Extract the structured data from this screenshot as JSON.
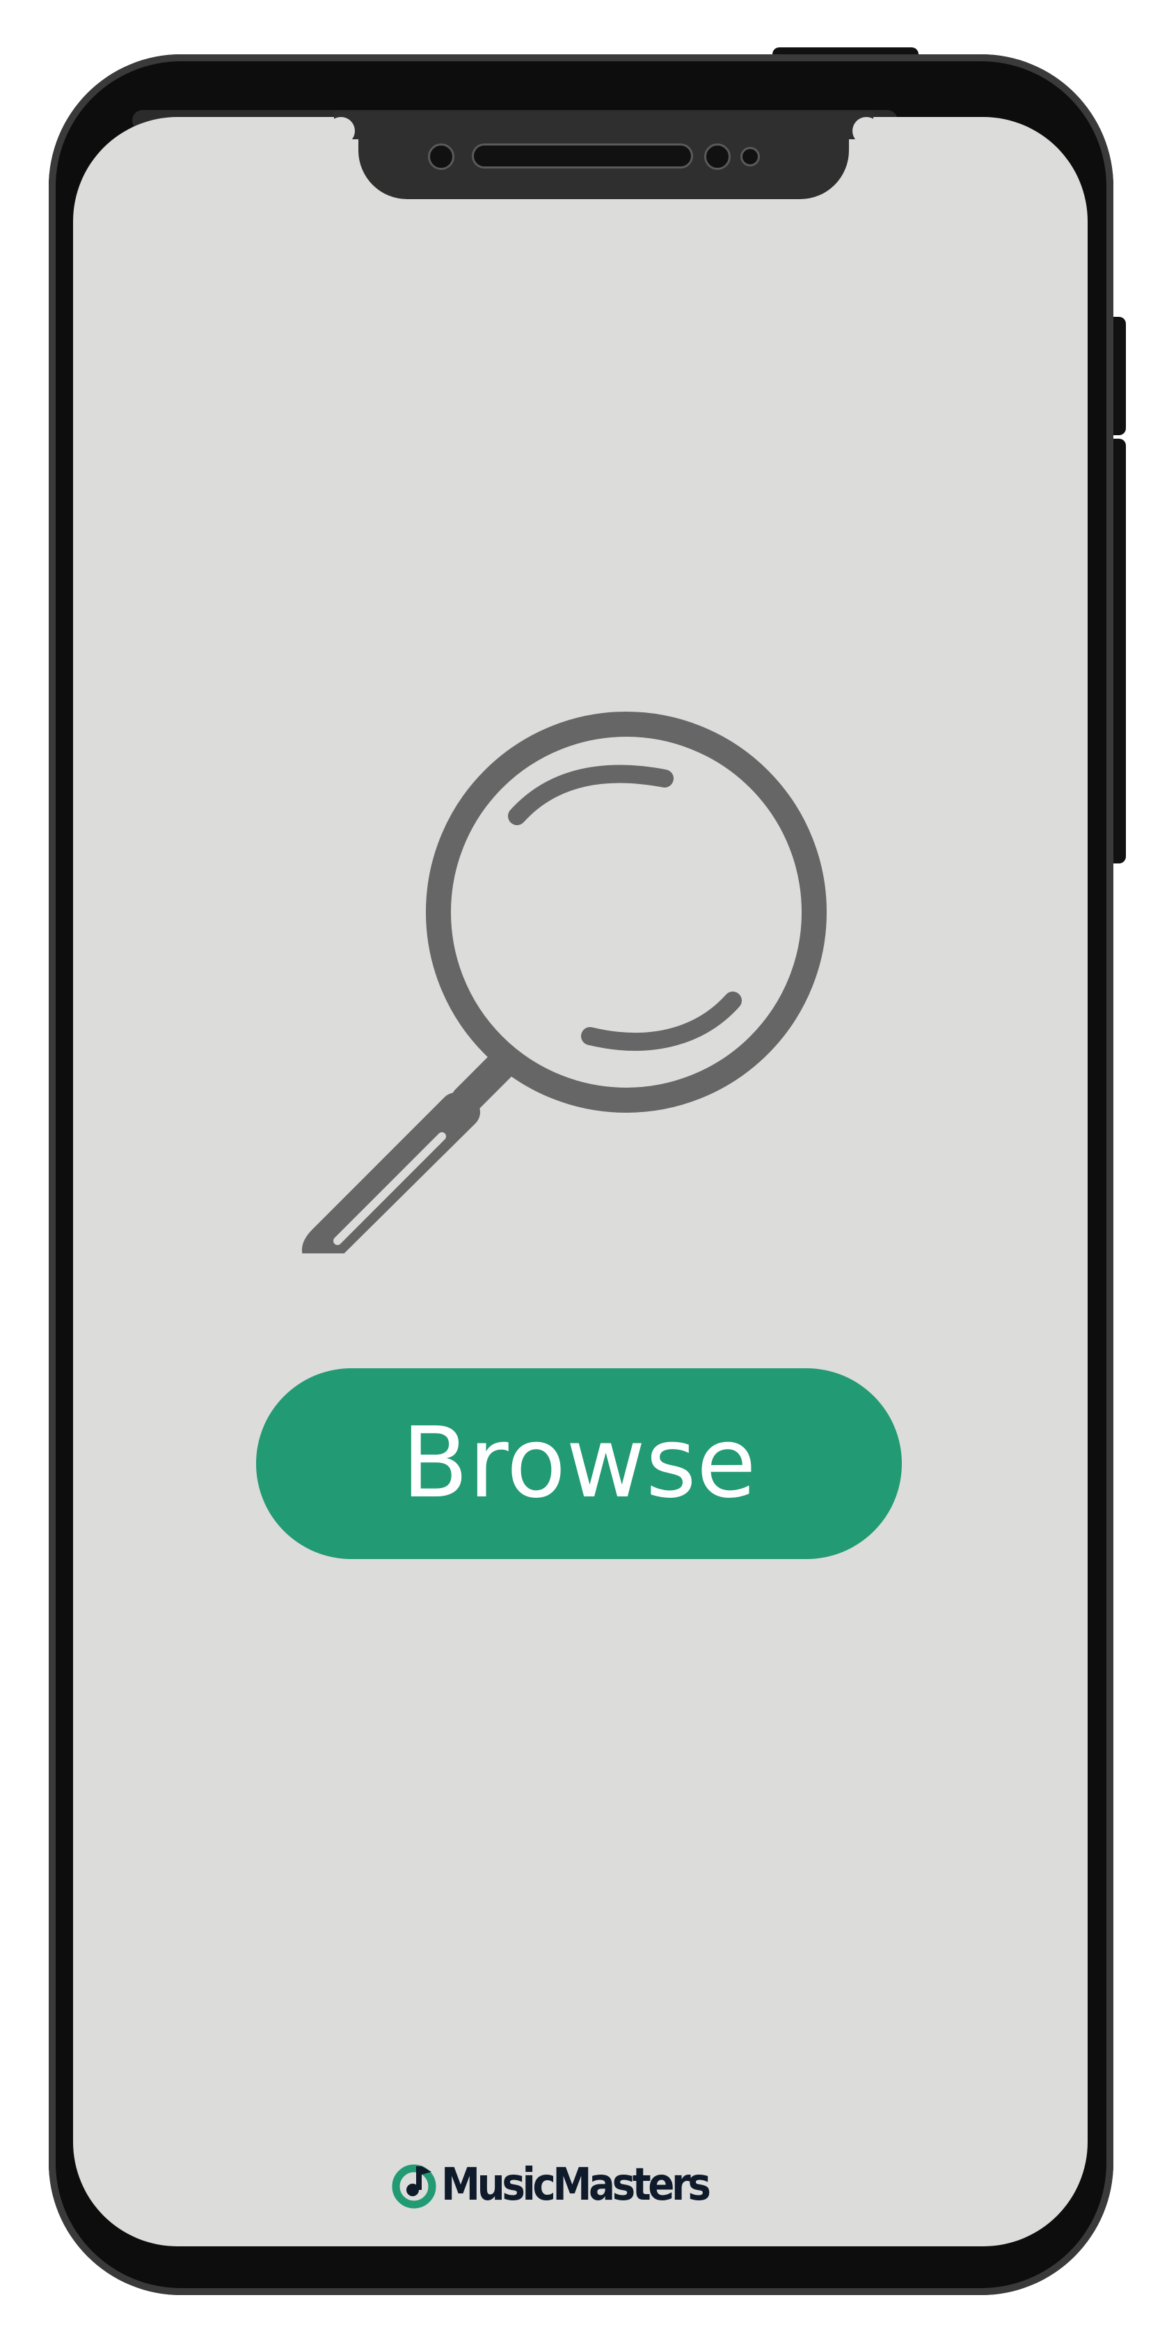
{
  "screen": {
    "background_color": "#dcdcdb",
    "illustration_icon": "search-icon",
    "illustration_color": "#666666"
  },
  "primary_action": {
    "label": "Browse",
    "color": "#229a73",
    "text_color": "#ffffff"
  },
  "brand": {
    "name": "MusicMasters",
    "icon": "music-note-logo-icon",
    "accent_color": "#229a73",
    "text_color": "#0f1b2a"
  }
}
